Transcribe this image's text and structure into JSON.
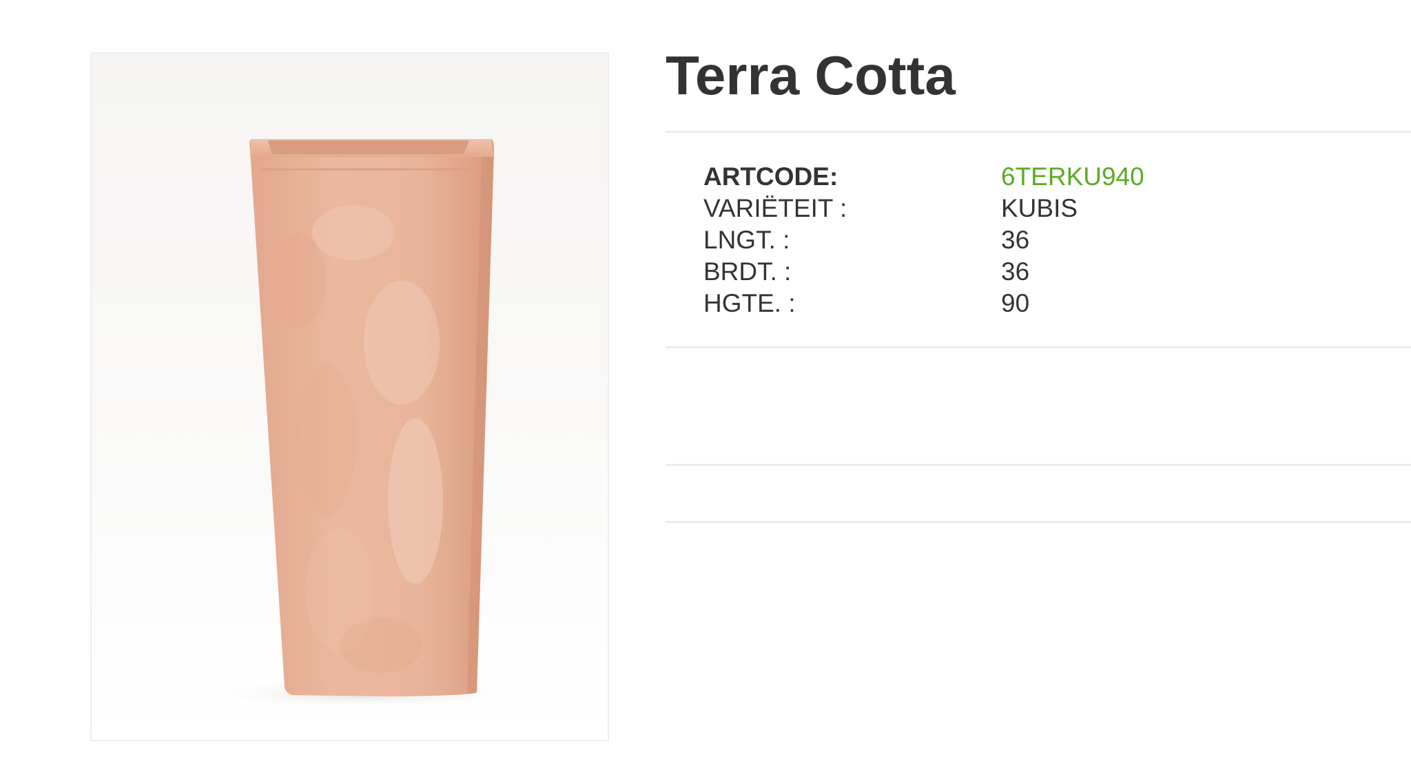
{
  "product": {
    "title": "Terra Cotta",
    "image_alt_icon": "terracotta-pot-image"
  },
  "specs": [
    {
      "label": "ARTCODE:",
      "value": "6TERKU940"
    },
    {
      "label": "VARIËTEIT :",
      "value": "KUBIS"
    },
    {
      "label": "LNGT. :",
      "value": "36"
    },
    {
      "label": "BRDT. :",
      "value": "36"
    },
    {
      "label": "HGTE. :",
      "value": "90"
    }
  ],
  "colors": {
    "accent_green": "#5aab23",
    "text": "#333333",
    "divider": "#ececec"
  }
}
